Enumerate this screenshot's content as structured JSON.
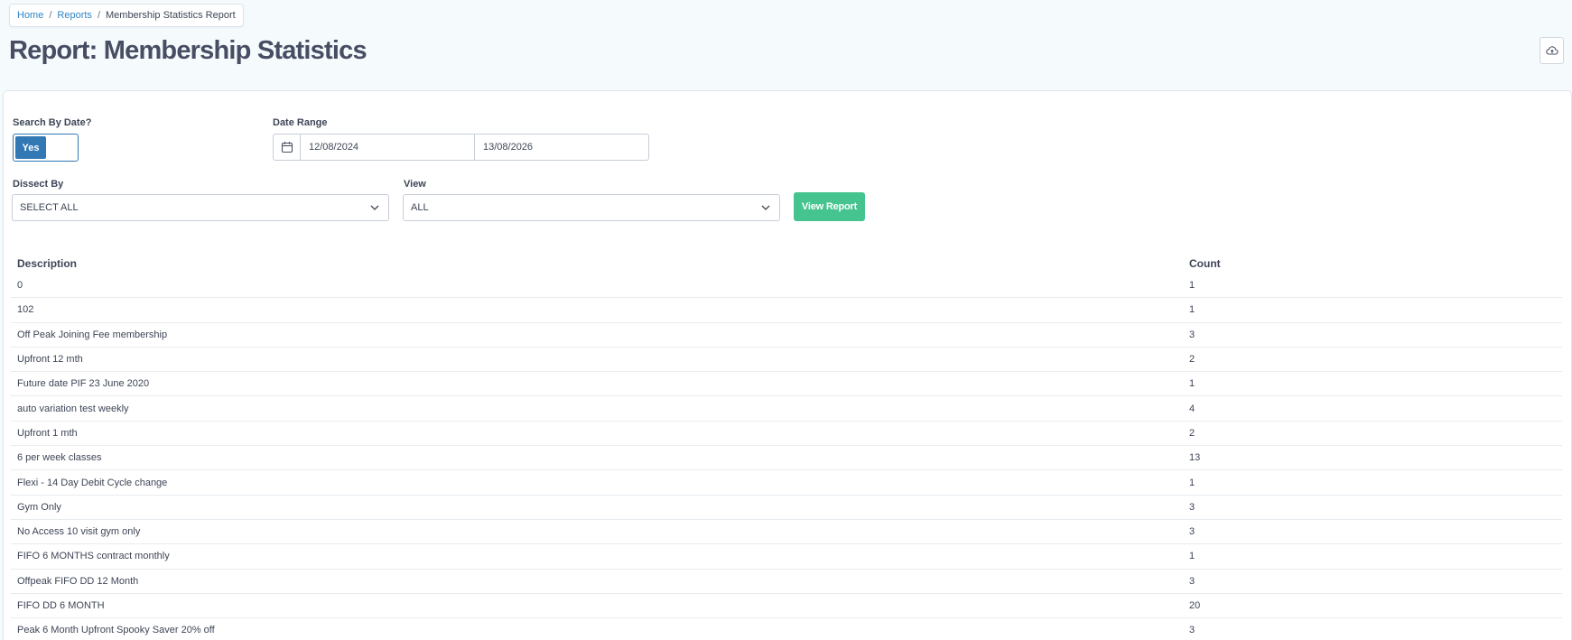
{
  "breadcrumb": {
    "home": "Home",
    "reports": "Reports",
    "current": "Membership Statistics Report",
    "separator": "/"
  },
  "page": {
    "title": "Report: Membership Statistics",
    "cloud_icon": "cloud-upload-icon"
  },
  "filters": {
    "search_by_date_label": "Search By Date?",
    "toggle_value": "Yes",
    "date_range_label": "Date Range",
    "date_from": "12/08/2024",
    "date_to": "13/08/2026",
    "dissect_by_label": "Dissect By",
    "dissect_by_value": "SELECT ALL",
    "view_label": "View",
    "view_value": "ALL",
    "view_report_button": "View Report"
  },
  "table": {
    "columns": [
      "Description",
      "Count"
    ],
    "rows": [
      {
        "description": "0",
        "count": "1"
      },
      {
        "description": "102",
        "count": "1"
      },
      {
        "description": "Off Peak Joining Fee membership",
        "count": "3"
      },
      {
        "description": "Upfront 12 mth",
        "count": "2"
      },
      {
        "description": "Future date PIF 23 June 2020",
        "count": "1"
      },
      {
        "description": "auto variation test weekly",
        "count": "4"
      },
      {
        "description": "Upfront 1 mth",
        "count": "2"
      },
      {
        "description": "6 per week classes",
        "count": "13"
      },
      {
        "description": "Flexi - 14 Day Debit Cycle change",
        "count": "1"
      },
      {
        "description": "Gym Only",
        "count": "3"
      },
      {
        "description": "No Access 10 visit gym only",
        "count": "3"
      },
      {
        "description": "FIFO 6 MONTHS contract monthly",
        "count": "1"
      },
      {
        "description": "Offpeak FIFO DD 12 Month",
        "count": "3"
      },
      {
        "description": "FIFO DD 6 MONTH",
        "count": "20"
      },
      {
        "description": "Peak 6 Month Upfront Spooky Saver 20% off",
        "count": "3"
      }
    ]
  },
  "colors": {
    "link": "#2f86c5",
    "primary": "#3278b5",
    "success": "#45c48f",
    "title": "#474d62"
  }
}
